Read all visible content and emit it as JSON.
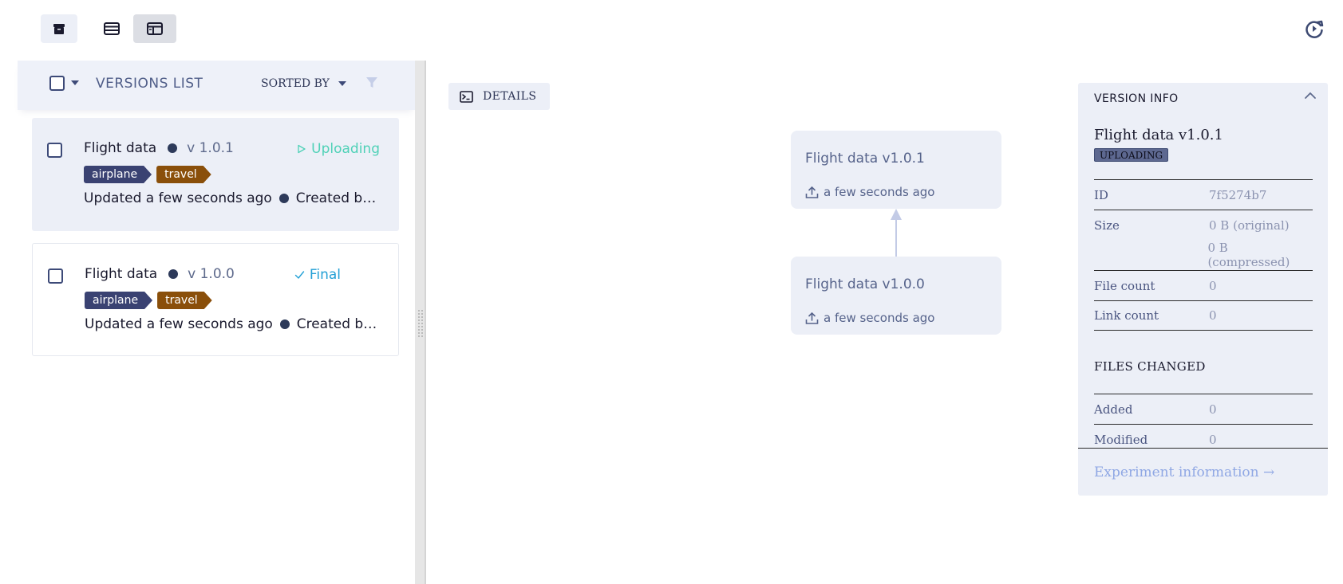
{
  "toolbar": {
    "icons": {
      "archive": "archive-icon",
      "list": "list-view-icon",
      "details": "details-view-icon",
      "refresh": "refresh-icon"
    }
  },
  "versions_list": {
    "title": "VERSIONS LIST",
    "sort_label": "SORTED BY",
    "items": [
      {
        "name": "Flight data",
        "version": "v 1.0.1",
        "status": "Uploading",
        "status_color": "#4fd1b7",
        "tags": [
          {
            "label": "airplane",
            "color": "#3a4272"
          },
          {
            "label": "travel",
            "color": "#8a4f0a"
          }
        ],
        "updated": "Updated a few seconds ago",
        "created": "Created by…"
      },
      {
        "name": "Flight data",
        "version": "v 1.0.0",
        "status": "Final",
        "status_color": "#23a0d6",
        "tags": [
          {
            "label": "airplane",
            "color": "#3a4272"
          },
          {
            "label": "travel",
            "color": "#8a4f0a"
          }
        ],
        "updated": "Updated a few seconds ago",
        "created": "Created by…"
      }
    ]
  },
  "details_button": {
    "label": "DETAILS"
  },
  "graph": {
    "nodes": [
      {
        "title": "Flight data v1.0.1",
        "time": "a few seconds ago"
      },
      {
        "title": "Flight data v1.0.0",
        "time": "a few seconds ago"
      }
    ]
  },
  "version_info": {
    "header": "VERSION INFO",
    "title": "Flight data v1.0.1",
    "badge": "UPLOADING",
    "rows": [
      {
        "label": "ID",
        "value": "7f5274b7"
      },
      {
        "label": "Size",
        "value": "0 B (original)"
      },
      {
        "label": "",
        "value": "0 B (compressed)"
      },
      {
        "label": "File count",
        "value": "0"
      },
      {
        "label": "Link count",
        "value": "0"
      }
    ],
    "files_changed_header": "FILES CHANGED",
    "files_rows": [
      {
        "label": "Added",
        "value": "0"
      },
      {
        "label": "Modified",
        "value": "0"
      }
    ],
    "experiment_link": "Experiment information →"
  }
}
